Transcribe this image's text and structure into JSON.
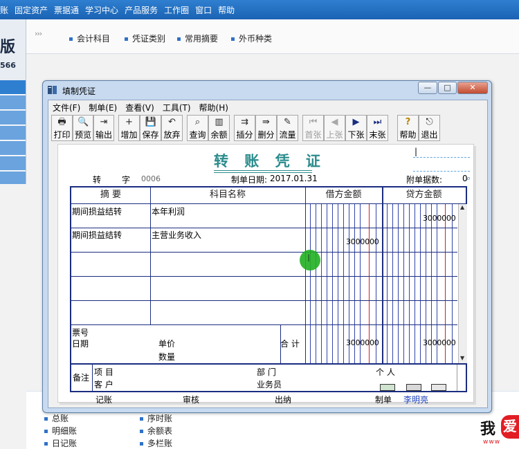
{
  "app": {
    "menu": [
      "账",
      "固定资产",
      "票据通",
      "学习中心",
      "产品服务",
      "工作圈",
      "窗口",
      "帮助"
    ],
    "brand": "版",
    "brand_number": "566",
    "quick_links": [
      "会计科目",
      "凭证类别",
      "常用摘要",
      "外币种类"
    ],
    "bottom_links": [
      "总账",
      "明细账",
      "日记账",
      "序时账",
      "余额表",
      "多栏账"
    ],
    "watermark": "我",
    "watermark_red": "爱",
    "watermark_url": "www"
  },
  "dialog": {
    "title": "填制凭证",
    "window_buttons": [
      "—",
      "□",
      "✕"
    ],
    "menu": [
      "文件(F)",
      "制单(E)",
      "查看(V)",
      "工具(T)",
      "帮助(H)"
    ],
    "toolbar": [
      {
        "label": "打印",
        "icon": "🖶",
        "enabled": true
      },
      {
        "label": "预览",
        "icon": "🔍",
        "enabled": true
      },
      {
        "label": "输出",
        "icon": "⇥",
        "enabled": true
      },
      {
        "label": "增加",
        "icon": "+",
        "enabled": true
      },
      {
        "label": "保存",
        "icon": "💾",
        "enabled": true
      },
      {
        "label": "放弃",
        "icon": "↶",
        "enabled": true
      },
      {
        "label": "查询",
        "icon": "⌕",
        "enabled": true
      },
      {
        "label": "余额",
        "icon": "▥",
        "enabled": true
      },
      {
        "label": "插分",
        "icon": "⇉",
        "enabled": true
      },
      {
        "label": "删分",
        "icon": "⇛",
        "enabled": true
      },
      {
        "label": "流量",
        "icon": "✎",
        "enabled": true
      },
      {
        "label": "首张",
        "icon": "⏮",
        "enabled": false
      },
      {
        "label": "上张",
        "icon": "◀",
        "enabled": false
      },
      {
        "label": "下张",
        "icon": "▶",
        "enabled": true
      },
      {
        "label": "末张",
        "icon": "⏭",
        "enabled": true
      },
      {
        "label": "帮助",
        "icon": "?",
        "enabled": true
      },
      {
        "label": "退出",
        "icon": "⎋",
        "enabled": true
      }
    ]
  },
  "voucher": {
    "title": "转 账 凭 证",
    "cursor": "|",
    "type_label": "转",
    "zi_label": "字",
    "number": "0006",
    "date_label": "制单日期:",
    "date": "2017.01.31",
    "attach_label": "附单据数:",
    "attach_count": "0",
    "headers": {
      "summary": "摘  要",
      "account": "科目名称",
      "debit": "借方金额",
      "credit": "贷方金额"
    },
    "rows": [
      {
        "summary": "期间损益结转",
        "account": "本年利润",
        "debit": "",
        "credit": "3000000"
      },
      {
        "summary": "期间损益结转",
        "account": "主营业务收入",
        "debit": "3000000",
        "credit": ""
      },
      {
        "summary": "",
        "account": "",
        "debit": "",
        "credit": ""
      },
      {
        "summary": "",
        "account": "",
        "debit": "",
        "credit": ""
      },
      {
        "summary": "",
        "account": "",
        "debit": "",
        "credit": ""
      }
    ],
    "bill_no_label": "票号",
    "bill_date_label": "日期",
    "unit_price_label": "单价",
    "quantity_label": "数量",
    "total_label": "合 计",
    "total_debit": "3000000",
    "total_credit": "3000000",
    "remark_label": "备注",
    "project_label": "项  目",
    "customer_label": "客  户",
    "dept_label": "部  门",
    "salesman_label": "业务员",
    "person_label": "个  人",
    "cursor_glyph": "I",
    "footer": {
      "bookkeeping": "记账",
      "review": "审核",
      "cashier": "出纳",
      "maker_label": "制单",
      "maker": "李明亮"
    }
  }
}
